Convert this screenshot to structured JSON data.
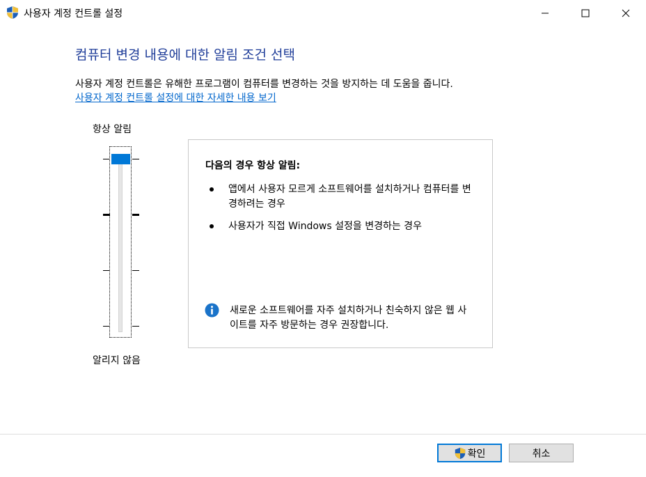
{
  "window": {
    "title": "사용자 계정 컨트롤 설정",
    "controls": {
      "minimize_icon": "minimize-icon",
      "maximize_icon": "maximize-icon",
      "close_icon": "close-icon"
    }
  },
  "main": {
    "heading": "컴퓨터 변경 내용에 대한 알림 조건 선택",
    "description": "사용자 계정 컨트롤은 유해한 프로그램이 컴퓨터를 변경하는 것을 방지하는 데 도움을 줍니다.",
    "link": "사용자 계정 컨트롤 설정에 대한 자세한 내용 보기"
  },
  "slider": {
    "top_label": "항상 알림",
    "bottom_label": "알리지 않음",
    "levels": 4,
    "selected_level": 4
  },
  "info_panel": {
    "title": "다음의 경우 항상 알림:",
    "bullets": [
      "앱에서 사용자 모르게 소프트웨어를 설치하거나 컴퓨터를 변경하려는 경우",
      "사용자가 직접 Windows 설정을 변경하는 경우"
    ],
    "note": "새로운 소프트웨어를 자주 설치하거나 친숙하지 않은 웹 사이트를 자주 방문하는 경우 권장합니다."
  },
  "buttons": {
    "ok": "확인",
    "cancel": "취소"
  },
  "colors": {
    "heading": "#1f3d99",
    "link": "#0066cc",
    "accent": "#0078d7"
  }
}
